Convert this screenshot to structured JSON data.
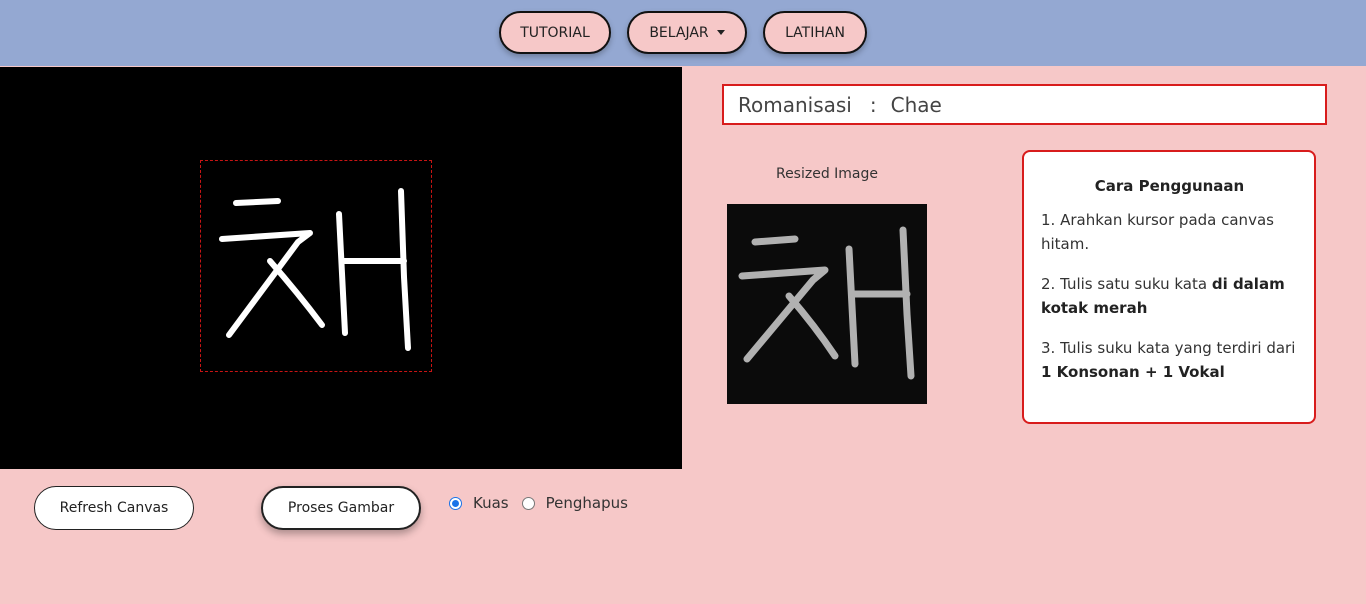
{
  "nav": {
    "tutorial": "TUTORIAL",
    "belajar": "BELAJAR",
    "latihan": "LATIHAN"
  },
  "result": {
    "label": "Romanisasi",
    "separator": ":",
    "value": "Chae"
  },
  "resized": {
    "label": "Resized Image"
  },
  "guide": {
    "title": "Cara Penggunaan",
    "step1": "1. Arahkan kursor pada canvas hitam.",
    "step2_prefix": "2. Tulis satu suku kata ",
    "step2_bold": "di dalam kotak merah",
    "step3_prefix": "3. Tulis suku kata yang terdiri dari ",
    "step3_bold": "1 Konsonan + 1 Vokal"
  },
  "controls": {
    "refresh_label": "Refresh Canvas",
    "proses_label": "Proses Gambar",
    "mode_options": [
      "Kuas",
      "Penghapus"
    ],
    "mode_selected": "Kuas"
  },
  "colors": {
    "navbar": "#94a8d2",
    "background": "#f6c8c8",
    "accent_red": "#d81c1c",
    "radio_blue": "#1a73e8"
  }
}
